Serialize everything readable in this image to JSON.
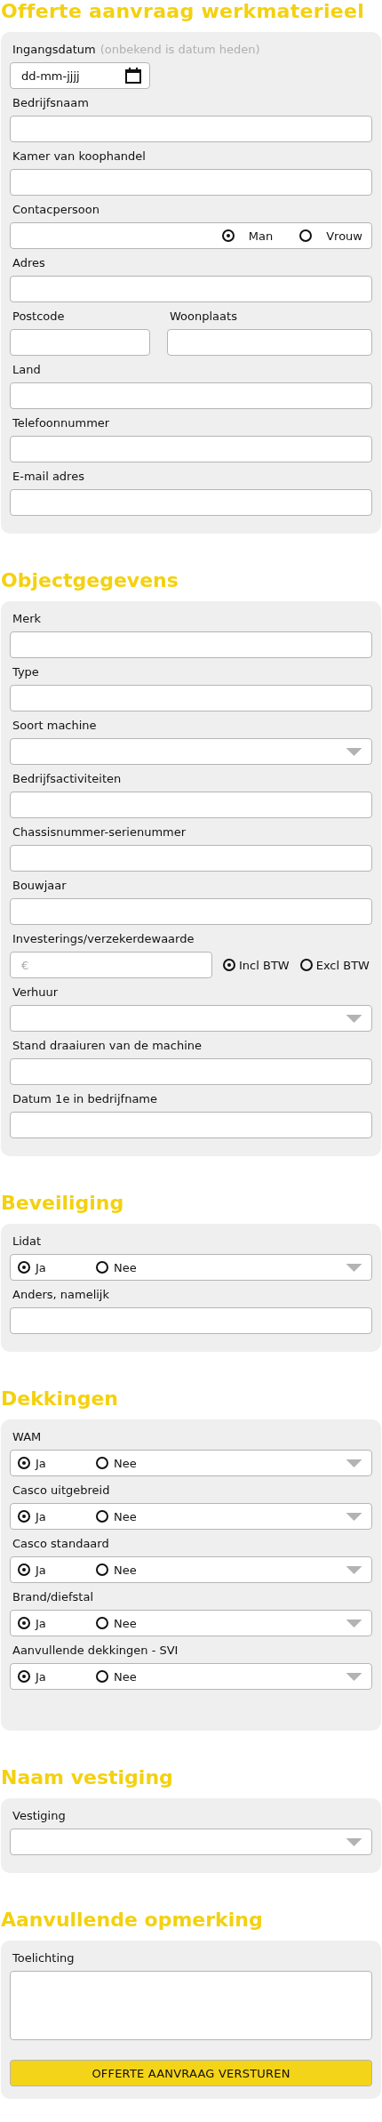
{
  "title": "Offerte aanvraag werkmaterieel",
  "sections": [
    {
      "fields": [
        {
          "kind": "date",
          "label": "Ingangsdatum",
          "hint": "(onbekend is datum heden)",
          "placeholder": "dd-mm-jjjj"
        },
        {
          "kind": "text",
          "label": "Bedrijfsnaam"
        },
        {
          "kind": "text",
          "label": "Kamer van koophandel"
        },
        {
          "kind": "text_radio",
          "label": "Contacpersoon",
          "options": [
            {
              "label": "Man",
              "selected": true
            },
            {
              "label": "Vrouw",
              "selected": false
            }
          ]
        },
        {
          "kind": "text",
          "label": "Adres"
        },
        {
          "kind": "pair",
          "fields": [
            {
              "label": "Postcode"
            },
            {
              "label": "Woonplaats"
            }
          ]
        },
        {
          "kind": "text",
          "label": "Land"
        },
        {
          "kind": "text",
          "label": "Telefoonnummer"
        },
        {
          "kind": "text",
          "label": "E-mail adres"
        }
      ]
    },
    {
      "heading": "Objectgegevens",
      "fields": [
        {
          "kind": "text",
          "label": "Merk"
        },
        {
          "kind": "text",
          "label": "Type"
        },
        {
          "kind": "select",
          "label": "Soort machine"
        },
        {
          "kind": "text",
          "label": "Bedrijfsactiviteiten"
        },
        {
          "kind": "text",
          "label": "Chassisnummer-serienummer"
        },
        {
          "kind": "text",
          "label": "Bouwjaar"
        },
        {
          "kind": "money_radio",
          "label": "Investerings/verzekerdewaarde",
          "placeholder": "€",
          "options": [
            {
              "label": "Incl BTW",
              "selected": true
            },
            {
              "label": "Excl BTW",
              "selected": false
            }
          ]
        },
        {
          "kind": "select",
          "label": "Verhuur"
        },
        {
          "kind": "text",
          "label": "Stand draaiuren van de machine"
        },
        {
          "kind": "text",
          "label": "Datum 1e in bedrijfname"
        }
      ]
    },
    {
      "heading": "Beveiliging",
      "fields": [
        {
          "kind": "radio_select",
          "label": "Lidat",
          "options": [
            {
              "label": "Ja",
              "selected": true
            },
            {
              "label": "Nee",
              "selected": false
            }
          ]
        },
        {
          "kind": "text",
          "label": "Anders, namelijk"
        }
      ]
    },
    {
      "heading": "Dekkingen",
      "fields": [
        {
          "kind": "radio_select",
          "label": "WAM",
          "options": [
            {
              "label": "Ja",
              "selected": true
            },
            {
              "label": "Nee",
              "selected": false
            }
          ]
        },
        {
          "kind": "radio_select",
          "label": "Casco uitgebreid",
          "options": [
            {
              "label": "Ja",
              "selected": true
            },
            {
              "label": "Nee",
              "selected": false
            }
          ]
        },
        {
          "kind": "radio_select",
          "label": "Casco standaard",
          "options": [
            {
              "label": "Ja",
              "selected": true
            },
            {
              "label": "Nee",
              "selected": false
            }
          ]
        },
        {
          "kind": "radio_select",
          "label": "Brand/diefstal",
          "options": [
            {
              "label": "Ja",
              "selected": true
            },
            {
              "label": "Nee",
              "selected": false
            }
          ]
        },
        {
          "kind": "radio_select",
          "label": "Aanvullende dekkingen - SVI",
          "options": [
            {
              "label": "Ja",
              "selected": true
            },
            {
              "label": "Nee",
              "selected": false
            }
          ]
        }
      ]
    },
    {
      "heading": "Naam vestiging",
      "fields": [
        {
          "kind": "select",
          "label": "Vestiging"
        }
      ]
    },
    {
      "heading": "Aanvullende opmerking",
      "fields": [
        {
          "kind": "textarea",
          "label": "Toelichting"
        }
      ],
      "button": "OFFERTE AANVRAAG VERSTUREN"
    }
  ]
}
